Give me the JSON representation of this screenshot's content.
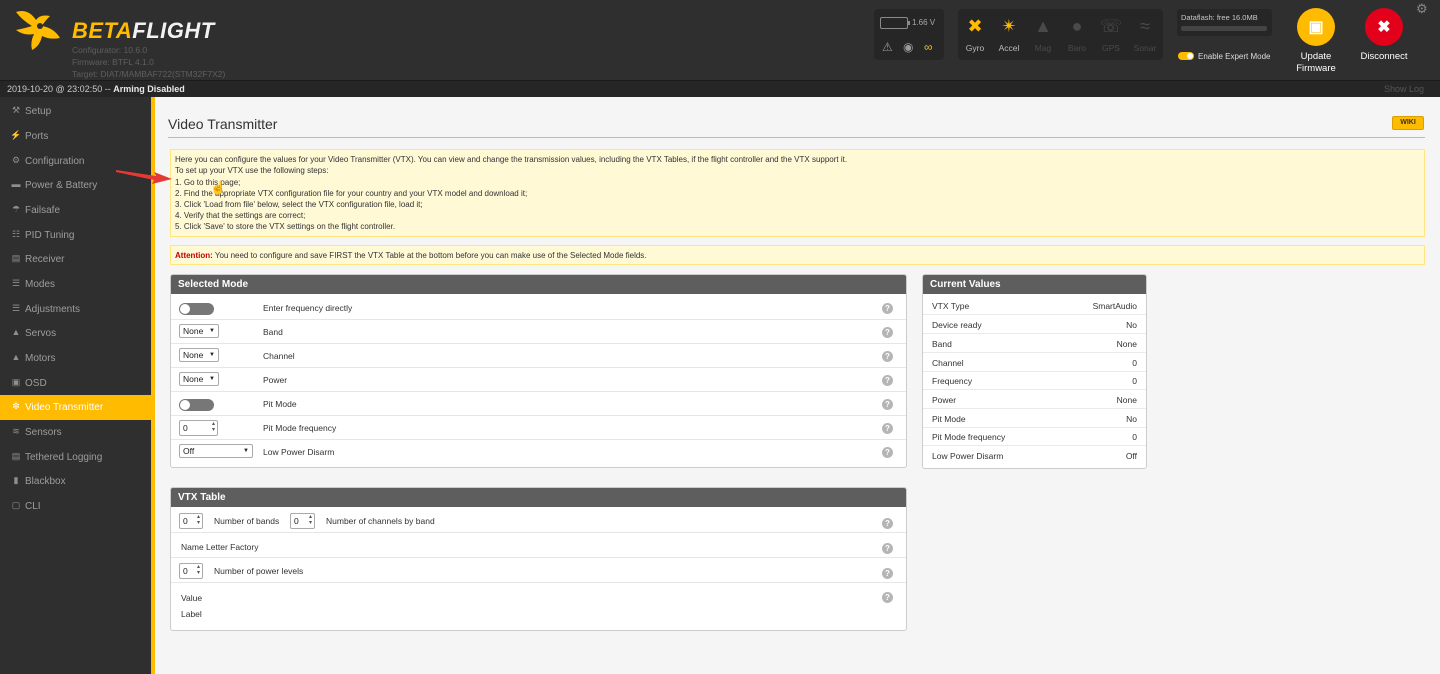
{
  "header": {
    "app_name_1": "BETA",
    "app_name_2": "FLIGHT",
    "configurator": "Configurator: 10.6.0",
    "firmware": "Firmware: BTFL 4.1.0",
    "target": "Target: DIAT/MAMBAF722(STM32F7X2)",
    "battery_voltage": "1.66 V",
    "sensors": [
      {
        "name": "Gyro",
        "icon": "gyro-icon",
        "active": true
      },
      {
        "name": "Accel",
        "icon": "accel-icon",
        "active": true
      },
      {
        "name": "Mag",
        "icon": "mag-icon",
        "active": false
      },
      {
        "name": "Baro",
        "icon": "baro-icon",
        "active": false
      },
      {
        "name": "GPS",
        "icon": "gps-icon",
        "active": false
      },
      {
        "name": "Sonar",
        "icon": "sonar-icon",
        "active": false
      }
    ],
    "dataflash": "Dataflash: free 16.0MB",
    "expert_mode_label": "Enable Expert Mode",
    "update_firmware_line1": "Update",
    "update_firmware_line2": "Firmware",
    "disconnect_label": "Disconnect",
    "accent_color": "#ffbb00",
    "disconnect_color": "#e2001a"
  },
  "status_bar": {
    "datetime": "2019-10-20 @ 23:02:50",
    "separator": " -- ",
    "arming": "Arming Disabled",
    "show_log": "Show Log"
  },
  "sidebar": {
    "items": [
      {
        "label": "Setup",
        "icon": "wrench-icon"
      },
      {
        "label": "Ports",
        "icon": "ports-icon"
      },
      {
        "label": "Configuration",
        "icon": "gear-icon"
      },
      {
        "label": "Power & Battery",
        "icon": "battery-icon"
      },
      {
        "label": "Failsafe",
        "icon": "parachute-icon"
      },
      {
        "label": "PID Tuning",
        "icon": "pid-icon"
      },
      {
        "label": "Receiver",
        "icon": "receiver-icon"
      },
      {
        "label": "Modes",
        "icon": "modes-icon"
      },
      {
        "label": "Adjustments",
        "icon": "sliders-icon"
      },
      {
        "label": "Servos",
        "icon": "servo-icon"
      },
      {
        "label": "Motors",
        "icon": "motor-icon"
      },
      {
        "label": "OSD",
        "icon": "osd-icon"
      },
      {
        "label": "Video Transmitter",
        "icon": "vtx-icon",
        "active": true
      },
      {
        "label": "Sensors",
        "icon": "sensors-icon"
      },
      {
        "label": "Tethered Logging",
        "icon": "logging-icon"
      },
      {
        "label": "Blackbox",
        "icon": "blackbox-icon"
      },
      {
        "label": "CLI",
        "icon": "cli-icon"
      }
    ]
  },
  "main": {
    "title": "Video Transmitter",
    "wiki": "WIKI",
    "note_lines": [
      "Here you can configure the values for your Video Transmitter (VTX). You can view and change the transmission values, including the VTX Tables, if the flight controller and the VTX support it.",
      "To set up your VTX use the following steps:",
      "1. Go to this page;",
      "2. Find the appropriate VTX configuration file for your country and your VTX model and download it;",
      "3. Click 'Load from file' below, select the VTX configuration file, load it;",
      "4. Verify that the settings are correct;",
      "5. Click 'Save' to store the VTX settings on the flight controller."
    ],
    "attention_label": "Attention:",
    "attention_text": " You need to configure and save FIRST the VTX Table at the bottom before you can make use of the Selected Mode fields."
  },
  "selected_mode": {
    "title": "Selected Mode",
    "enter_frequency_label": "Enter frequency directly",
    "band_value": "None",
    "band_label": "Band",
    "channel_value": "None",
    "channel_label": "Channel",
    "power_value": "None",
    "power_label": "Power",
    "pit_mode_label": "Pit Mode",
    "pit_mode_frequency_value": "0",
    "pit_mode_frequency_label": "Pit Mode frequency",
    "low_power_disarm_value": "Off",
    "low_power_disarm_label": "Low Power Disarm",
    "help": "?"
  },
  "current_values": {
    "title": "Current Values",
    "rows": [
      {
        "key": "VTX Type",
        "value": "SmartAudio"
      },
      {
        "key": "Device ready",
        "value": "No"
      },
      {
        "key": "Band",
        "value": "None"
      },
      {
        "key": "Channel",
        "value": "0"
      },
      {
        "key": "Frequency",
        "value": "0"
      },
      {
        "key": "Power",
        "value": "None"
      },
      {
        "key": "Pit Mode",
        "value": "No"
      },
      {
        "key": "Pit Mode frequency",
        "value": "0"
      },
      {
        "key": "Low Power Disarm",
        "value": "Off"
      }
    ]
  },
  "vtx_table": {
    "title": "VTX Table",
    "bands_value": "0",
    "bands_label": "Number of bands",
    "channels_value": "0",
    "channels_label": "Number of channels by band",
    "name_letter_factory": "Name Letter Factory",
    "power_levels_value": "0",
    "power_levels_label": "Number of power levels",
    "value_label": "Value",
    "label_label": "Label",
    "help": "?"
  }
}
